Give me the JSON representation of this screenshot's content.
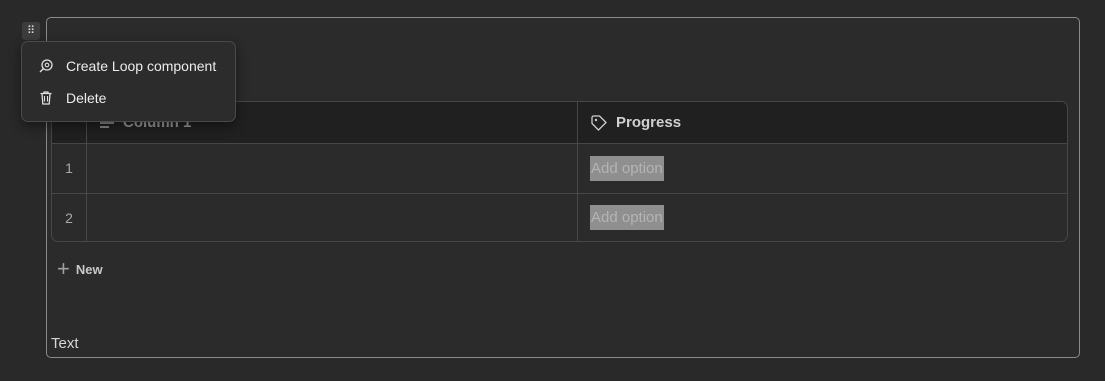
{
  "handle": {
    "glyph": "⠿"
  },
  "context_menu": {
    "items": [
      {
        "label": "Create Loop component",
        "icon": "loop-icon"
      },
      {
        "label": "Delete",
        "icon": "trash-icon"
      }
    ]
  },
  "table": {
    "columns": [
      {
        "label": "Column 1",
        "icon": "text-lines-icon"
      },
      {
        "label": "Progress",
        "icon": "tag-icon"
      }
    ],
    "rows": [
      {
        "number": "1",
        "progress_placeholder": "Add option"
      },
      {
        "number": "2",
        "progress_placeholder": "Add option"
      }
    ],
    "new_label": "New"
  },
  "text_block": {
    "label": "Text"
  },
  "colors": {
    "background": "#292929",
    "card_border": "#8a8a8a",
    "option_highlight": "#8f8f8f"
  }
}
